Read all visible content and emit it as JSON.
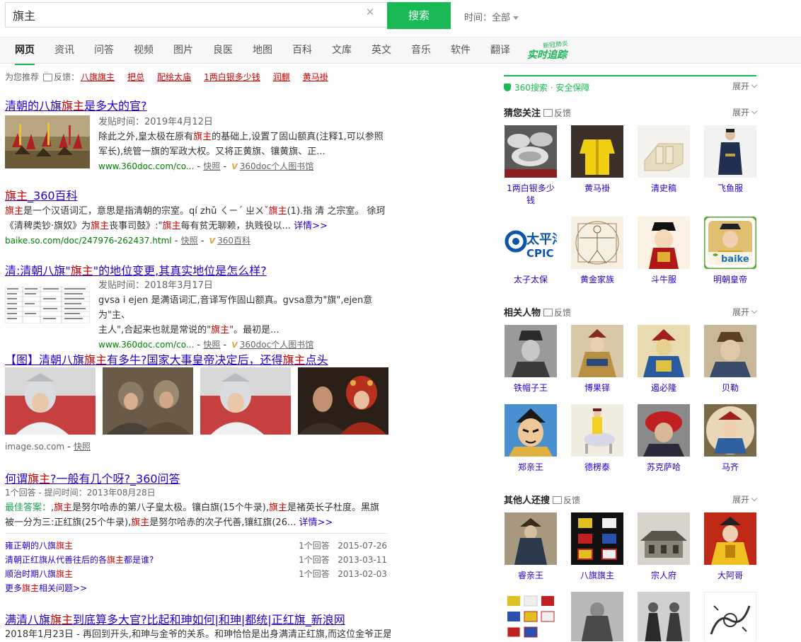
{
  "search": {
    "query": "旗主",
    "button": "搜索",
    "time_label": "时间：",
    "time_value": "全部"
  },
  "nav": {
    "tabs": [
      "网页",
      "资讯",
      "问答",
      "视频",
      "图片",
      "良医",
      "地图",
      "百科",
      "文库",
      "英文",
      "音乐",
      "软件",
      "翻译"
    ],
    "special_small": "新冠肺炎",
    "special_big": "实时追踪"
  },
  "recommend": {
    "label": "为您推荐",
    "feedback": "反馈：",
    "items": [
      "八旗旗主",
      "把总",
      "配绘太庙",
      "1两白银多少钱",
      "润麒",
      "黄马褂"
    ]
  },
  "results": {
    "r1": {
      "title_a": "清朝的八旗",
      "title_em": "旗主",
      "title_b": "是多大的官?",
      "date": "发贴时间：2019年4月12日",
      "line1_a": "除此之外,皇太极在原有",
      "line1_em": "旗主",
      "line1_b": "的基础上,设置了固山额真(注释1,可以参照",
      "line2": "军长),统管一旗的军政大权。又将正黄旗、镶黄旗、正...",
      "url": "www.360doc.com/co...",
      "snap": "快照",
      "source": "360doc个人图书馆"
    },
    "r2": {
      "title_em": "旗主",
      "title_b": "_360百科",
      "line1_em": "旗主",
      "line1_a": "是一个汉语词汇，意思是指清朝的宗室。qí zhǔ ㄑㄧˊ ㄓㄨˇ",
      "line1_em2": "旗主",
      "line1_b": "(1).指 清 之宗室。 徐珂",
      "line2_a": "《清稗类钞·旗奴》为",
      "line2_em": "旗主",
      "line2_b": "丧事司鼓》:\"",
      "line2_em2": "旗主",
      "line2_c": "每有贫无聊赖，执贱役以... ",
      "line2_more": "详情>>",
      "url": "baike.so.com/doc/247976-262437.html",
      "snap": "快照",
      "source": "360百科"
    },
    "r3": {
      "title_a": "清:清朝八旗\"",
      "title_em": "旗主",
      "title_b": "\"的地位变更,其真实地位是怎么样?",
      "date": "发贴时间：2018年3月17日",
      "line1": "gvsa i ejen 是满语词汇,音译写作固山额真。gvsa意为\"旗\",ejen意为\"主、",
      "line2_a": "主人\",合起来也就是常说的\"",
      "line2_em": "旗主",
      "line2_b": "\"。最初是...",
      "url": "www.360doc.com/co...",
      "snap": "快照",
      "source": "360doc个人图书馆"
    },
    "r4": {
      "title_a": "【图】清朝八旗",
      "title_em": "旗主",
      "title_b": "有多牛?国家大事皇帝决定后，还得",
      "title_em2": "旗主",
      "title_c": "点头",
      "url": "image.so.com",
      "snap": "快照"
    },
    "r5": {
      "title_a": "何谓",
      "title_em": "旗主",
      "title_b": "?一般有几个呀?_360问答",
      "meta": "1个回答 - 提问时间：2013年08月28日",
      "best": "最佳答案：",
      "line1_a": ",",
      "line1_em": "旗主",
      "line1_b": "是努尔哈赤的第八子皇太极。镶白旗(15个牛录),",
      "line1_em2": "旗主",
      "line1_c": "是褚英长子杜度。黑旗",
      "line2_a": "被一分为三:正红旗(25个牛录),",
      "line2_em": "旗主",
      "line2_b": "是努尔哈赤的次子代善,镶红旗(26... ",
      "line2_more": "详情>>",
      "qa": [
        {
          "q_a": "雍正朝的八旗",
          "q_em": "旗主",
          "q_b": "",
          "count": "1个回答",
          "date": "2015-07-26"
        },
        {
          "q_a": "清朝正红旗从代善往后的各",
          "q_em": "旗主",
          "q_b": "都是谁?",
          "count": "1个回答",
          "date": "2013-03-11"
        },
        {
          "q_a": "顺治时期八旗",
          "q_em": "旗主",
          "q_b": "",
          "count": "1个回答",
          "date": "2013-02-03"
        }
      ],
      "more_a": "更多",
      "more_em": "旗主",
      "more_b": "相关问题>>"
    },
    "r6": {
      "title_a": "满清八旗",
      "title_em": "旗主",
      "title_b": "到底算多大官?比起和珅如何|和珅|都统|正红旗_新浪网",
      "line1": "2018年1月23日 - 再回到开头,和珅与金爷的关系。和珅恰恰是出身满清正红旗,而这位金爷正是"
    }
  },
  "right": {
    "safety": "360搜索 · 安全保障",
    "expand": "展开",
    "feedback": "反馈",
    "sec1": {
      "title": "猜您关注",
      "items": [
        "1两白银多少钱",
        "黄马褂",
        "清史稿",
        "飞鱼服",
        "太子太保",
        "黄金家族",
        "斗牛服",
        "明朝皇帝"
      ]
    },
    "sec2": {
      "title": "相关人物",
      "items": [
        "铁帽子王",
        "博果铎",
        "遏必隆",
        "贝勒",
        "郑亲王",
        "德楞泰",
        "苏克萨哈",
        "马齐"
      ]
    },
    "sec3": {
      "title": "其他人还搜",
      "items": [
        "睿亲王",
        "八旗旗主",
        "宗人府",
        "大阿哥"
      ]
    }
  },
  "logos": {
    "cpic_text": "太平洋",
    "cpic_sub": "CPIC",
    "baike": "baike"
  },
  "colors": {
    "accent": "#19b955",
    "link": "#2222cc",
    "highlight": "#cc0000",
    "url": "#008000"
  }
}
